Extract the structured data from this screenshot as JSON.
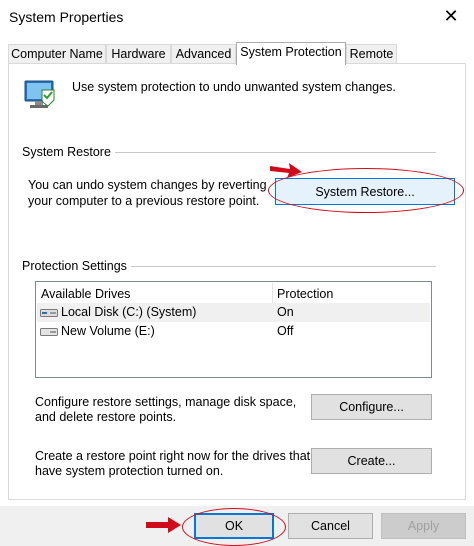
{
  "window": {
    "title": "System Properties",
    "close_glyph": "✕"
  },
  "tabs": [
    {
      "label": "Computer Name",
      "active": false
    },
    {
      "label": "Hardware",
      "active": false
    },
    {
      "label": "Advanced",
      "active": false
    },
    {
      "label": "System Protection",
      "active": true
    },
    {
      "label": "Remote",
      "active": false
    }
  ],
  "intro": {
    "icon": "system-protection-icon",
    "text": "Use system protection to undo unwanted system changes."
  },
  "system_restore": {
    "group_label": "System Restore",
    "description_line1": "You can undo system changes by reverting",
    "description_line2": "your computer to a previous restore point.",
    "button_label": "System Restore..."
  },
  "protection_settings": {
    "group_label": "Protection Settings",
    "columns": [
      "Available Drives",
      "Protection"
    ],
    "rows": [
      {
        "drive": "Local Disk (C:) (System)",
        "protection": "On",
        "icon": "system-drive-icon",
        "selected": true
      },
      {
        "drive": "New Volume (E:)",
        "protection": "Off",
        "icon": "drive-icon",
        "selected": false
      }
    ],
    "configure_text_line1": "Configure restore settings, manage disk space,",
    "configure_text_line2": "and delete restore points.",
    "configure_button": "Configure...",
    "create_text_line1": "Create a restore point right now for the drives that",
    "create_text_line2": "have system protection turned on.",
    "create_button": "Create..."
  },
  "footer": {
    "ok": "OK",
    "cancel": "Cancel",
    "apply": "Apply"
  },
  "colors": {
    "annotation_red": "#d10c1a",
    "focus_blue": "#0078d7"
  }
}
